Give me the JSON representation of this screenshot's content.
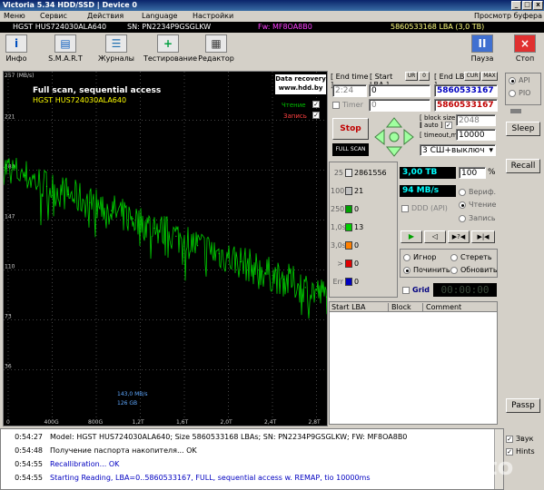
{
  "window": {
    "title": "Victoria 5.34 HDD/SSD | Device 0"
  },
  "menu": {
    "items": [
      "Меню",
      "Сервис",
      "Действия",
      "Language",
      "Настройки"
    ],
    "help": "Справка",
    "view_buffer": "Просмотр буфера"
  },
  "drive": {
    "model": "HGST HUS724030ALA640",
    "sn": "SN: PN2234P9GSGLKW",
    "fw": "Fw: MF8OA8B0",
    "lba": "5860533168 LBA (3,0 TB)"
  },
  "toolbar": {
    "info": "Инфо",
    "smart": "S.M.A.R.T",
    "logs": "Журналы",
    "test": "Тестирование",
    "editor": "Редактор",
    "pause": "Пауза",
    "stop": "Стоп"
  },
  "graph": {
    "unit": "257 (MB/s)",
    "title": "Full scan, sequential access",
    "subtitle": "HGST HUS724030ALA640",
    "badge_line1": "Data recovery",
    "badge_line2": "www.hdd.by",
    "read_label": "Чтение",
    "write_label": "Запись",
    "speed_readout": "143,0 MB/s",
    "size_readout": "126 GB",
    "y_ticks": [
      "221",
      "184",
      "147",
      "110",
      "73",
      "36"
    ],
    "x_ticks": [
      "0",
      "400G",
      "800G",
      "1,2T",
      "1,6T",
      "2,0T",
      "2,4T",
      "2,8T"
    ]
  },
  "chart_data": {
    "type": "line",
    "title": "Full scan, sequential access",
    "ylabel": "MB/s",
    "ylim": [
      0,
      257
    ],
    "xlim": [
      0,
      3.0
    ],
    "x_unit": "TB",
    "series": [
      {
        "x": [
          0.0,
          0.2,
          0.4,
          0.6,
          0.8,
          1.0,
          1.2,
          1.4,
          1.6,
          1.8,
          2.0,
          2.2,
          2.4,
          2.6,
          2.8,
          3.0
        ],
        "values": [
          186,
          180,
          172,
          166,
          160,
          154,
          148,
          141,
          135,
          128,
          122,
          116,
          109,
          103,
          97,
          90
        ]
      }
    ]
  },
  "controls": {
    "end_time_label": "[ End time ]",
    "start_lba_label": "[ Start LBA ]",
    "ur_label": "UR",
    "zero_label": "0",
    "end_lba_label": "[ End LBA ]",
    "cur_label": "CUR",
    "max_label": "MAX",
    "time_value": "2:24",
    "start_lba_value": "0",
    "end_lba_value": "5860533167",
    "timer_label": "Timer",
    "timer_value": "0",
    "end_lba_value2": "5860533167",
    "stop_button": "Stop",
    "full_scan_button": "FULL SCAN",
    "block_size_label": "[ block size ]",
    "auto_label": "[ auto ]",
    "block_size_value": "2048",
    "timeout_label": "[ timeout,ms ]",
    "timeout_value": "10000",
    "action_value": "3 СШ+выключ"
  },
  "stats": {
    "rows": [
      {
        "label": "25",
        "count": "2861556",
        "color": "#e8e8e8"
      },
      {
        "label": "100",
        "count": "21",
        "color": "#c0c0c0"
      },
      {
        "label": "250",
        "count": "0",
        "color": "#00a000"
      },
      {
        "label": "1,0s",
        "count": "13",
        "color": "#00d000"
      },
      {
        "label": "3,0s",
        "count": "0",
        "color": "#ff8000"
      },
      {
        "label": ">",
        "count": "0",
        "color": "#e00000"
      },
      {
        "label": "Err",
        "count": "0",
        "color": "#0000c0"
      }
    ],
    "total": "3,00 TB",
    "percent": "100",
    "percent_sign": "%",
    "speed": "94 MB/s",
    "verify": "Вериф.",
    "read": "Чтение",
    "write": "Запись",
    "ddd": "DDD (API)"
  },
  "mode": {
    "ignore": "Игнор",
    "erase": "Стереть",
    "fix": "Починить",
    "update": "Обновить",
    "grid": "Grid",
    "grid_timer": "00:00:00"
  },
  "table": {
    "headers": [
      "Start LBA",
      "Block",
      "Comment"
    ]
  },
  "side": {
    "api": "API",
    "pio": "PIO",
    "sleep": "Sleep",
    "recall": "Recall",
    "passp": "Passp",
    "sound": "Звук",
    "hints": "Hints"
  },
  "log": [
    {
      "time": "0:54:27",
      "text": "Model: HGST HUS724030ALA640; Size 5860533168 LBAs; SN: PN2234P9GSGLKW; FW: MF8OA8B0",
      "color": "#000000"
    },
    {
      "time": "0:54:48",
      "text": "Получение паспорта накопителя... OK",
      "color": "#000000"
    },
    {
      "time": "0:54:55",
      "text": "Recallibration... OK",
      "color": "#0000c0"
    },
    {
      "time": "0:54:55",
      "text": "Starting Reading, LBA=0..5860533167, FULL, sequential access w. REMAP, tio 10000ms",
      "color": "#0000c0"
    }
  ],
  "watermark": "Avito"
}
